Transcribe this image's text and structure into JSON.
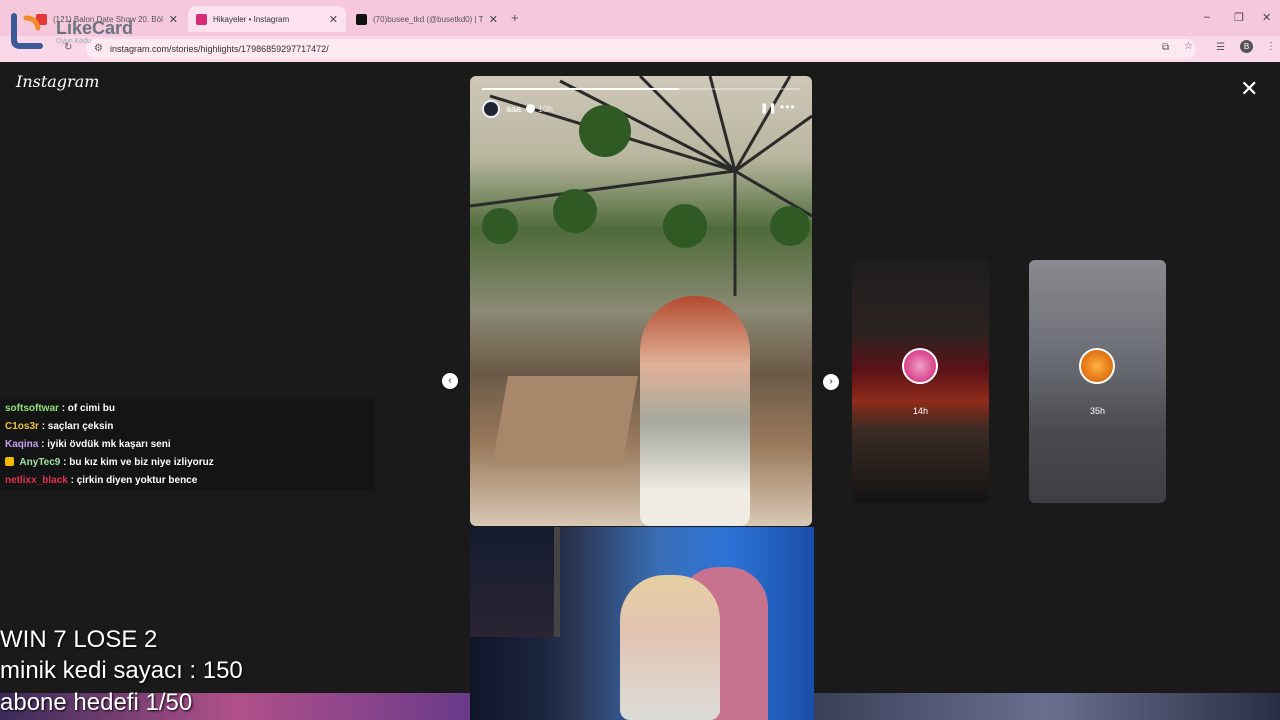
{
  "browser": {
    "tabs": [
      {
        "label": "(121) Balon Date Show 20. Bölü",
        "favicon_color": "#e53935",
        "active": false
      },
      {
        "label": "Hikayeler • Instagram",
        "favicon_color": "#d62976",
        "active": true
      },
      {
        "label": "(70)busee_tkd (@busetkd0) | Ti",
        "favicon_color": "#111111",
        "active": false
      }
    ],
    "url": "instagram.com/stories/highlights/17986859297717472/",
    "profile_initial": "B"
  },
  "overlay_logo": {
    "name": "LikeCard",
    "subtitle": "Oyun Kodu"
  },
  "instagram": {
    "logo": "Instagram",
    "story": {
      "username": "aaa",
      "time": "10h",
      "progress": 0.62
    },
    "thumbnails": [
      {
        "time": "14h"
      },
      {
        "time": "35h"
      }
    ]
  },
  "chat": [
    {
      "user": "softsoftwar",
      "color": "#8ee07a",
      "message": ": of cimi bu",
      "badge": false
    },
    {
      "user": "C1os3r",
      "color": "#e8c04a",
      "message": ": saçları çeksin",
      "badge": false
    },
    {
      "user": "Kaqina",
      "color": "#c8a0f0",
      "message": ": iyiki övdük mk kaşarı seni",
      "badge": false
    },
    {
      "user": "AnyTec9",
      "color": "#a0e0a0",
      "message": ": bu kız kim ve biz niye izliyoruz",
      "badge": true
    },
    {
      "user": "netlixx_black",
      "color": "#e03050",
      "message": ": çirkin diyen yoktur bence",
      "badge": false
    }
  ],
  "stream_overlay": {
    "line1": "WIN 7 LOSE 2",
    "line2": "minik kedi sayacı : 150",
    "line3": "abone hedefi 1/50"
  }
}
